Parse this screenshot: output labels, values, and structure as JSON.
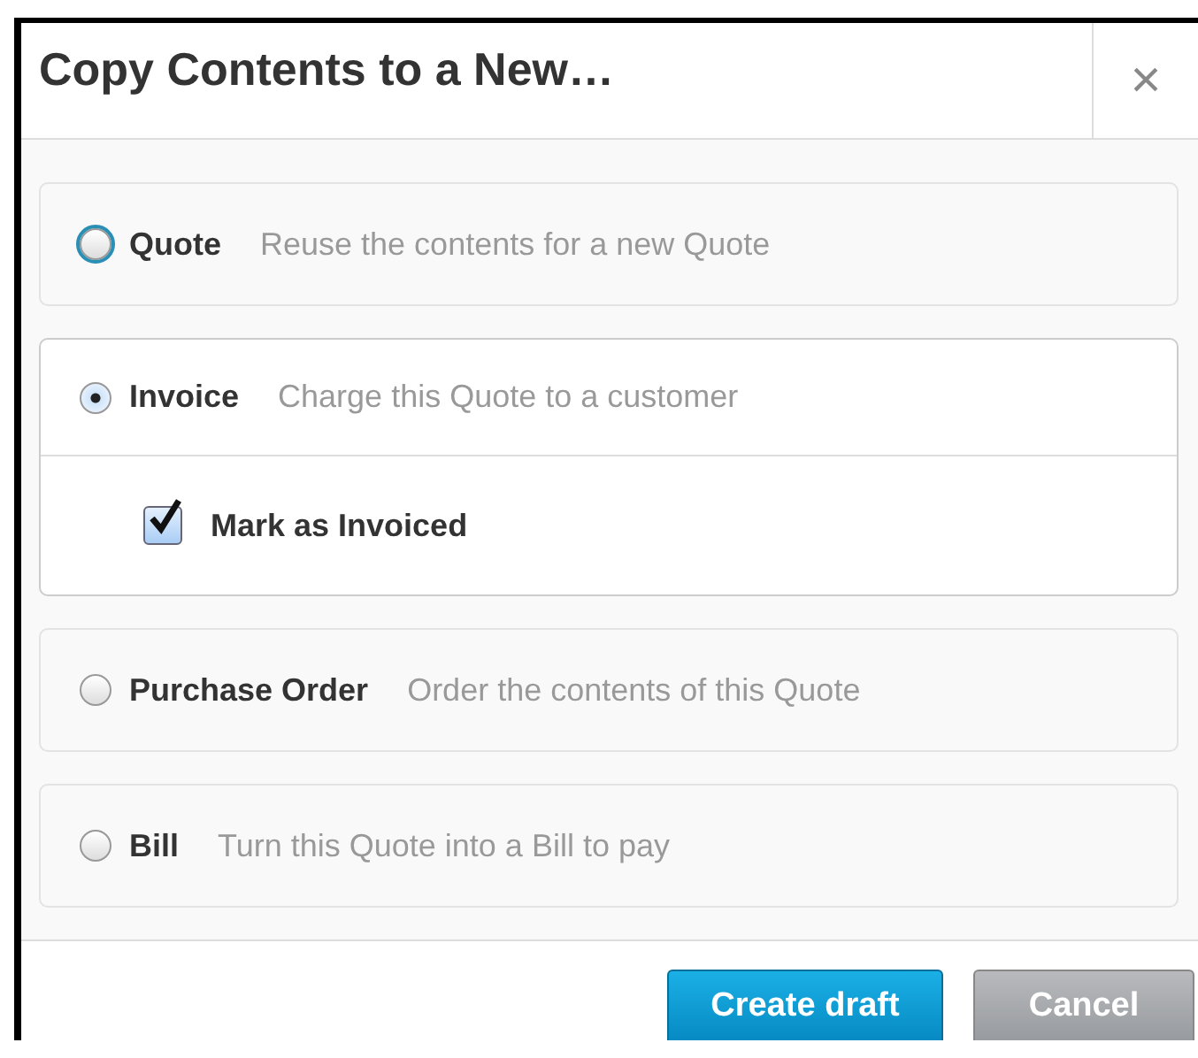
{
  "dialog": {
    "title": "Copy Contents to a New…",
    "close": "×"
  },
  "options": [
    {
      "label": "Quote",
      "description": "Reuse the contents for a new Quote",
      "selected": false,
      "focused": true
    },
    {
      "label": "Invoice",
      "description": "Charge this Quote to a customer",
      "selected": true,
      "focused": false,
      "sub_option": {
        "label": "Mark as Invoiced",
        "checked": true
      }
    },
    {
      "label": "Purchase Order",
      "description": "Order the contents of this Quote",
      "selected": false,
      "focused": false
    },
    {
      "label": "Bill",
      "description": "Turn this Quote into a Bill to pay",
      "selected": false,
      "focused": false
    }
  ],
  "buttons": [
    {
      "label": "Create draft",
      "kind": "primary"
    },
    {
      "label": "Cancel",
      "kind": "secondary"
    }
  ]
}
